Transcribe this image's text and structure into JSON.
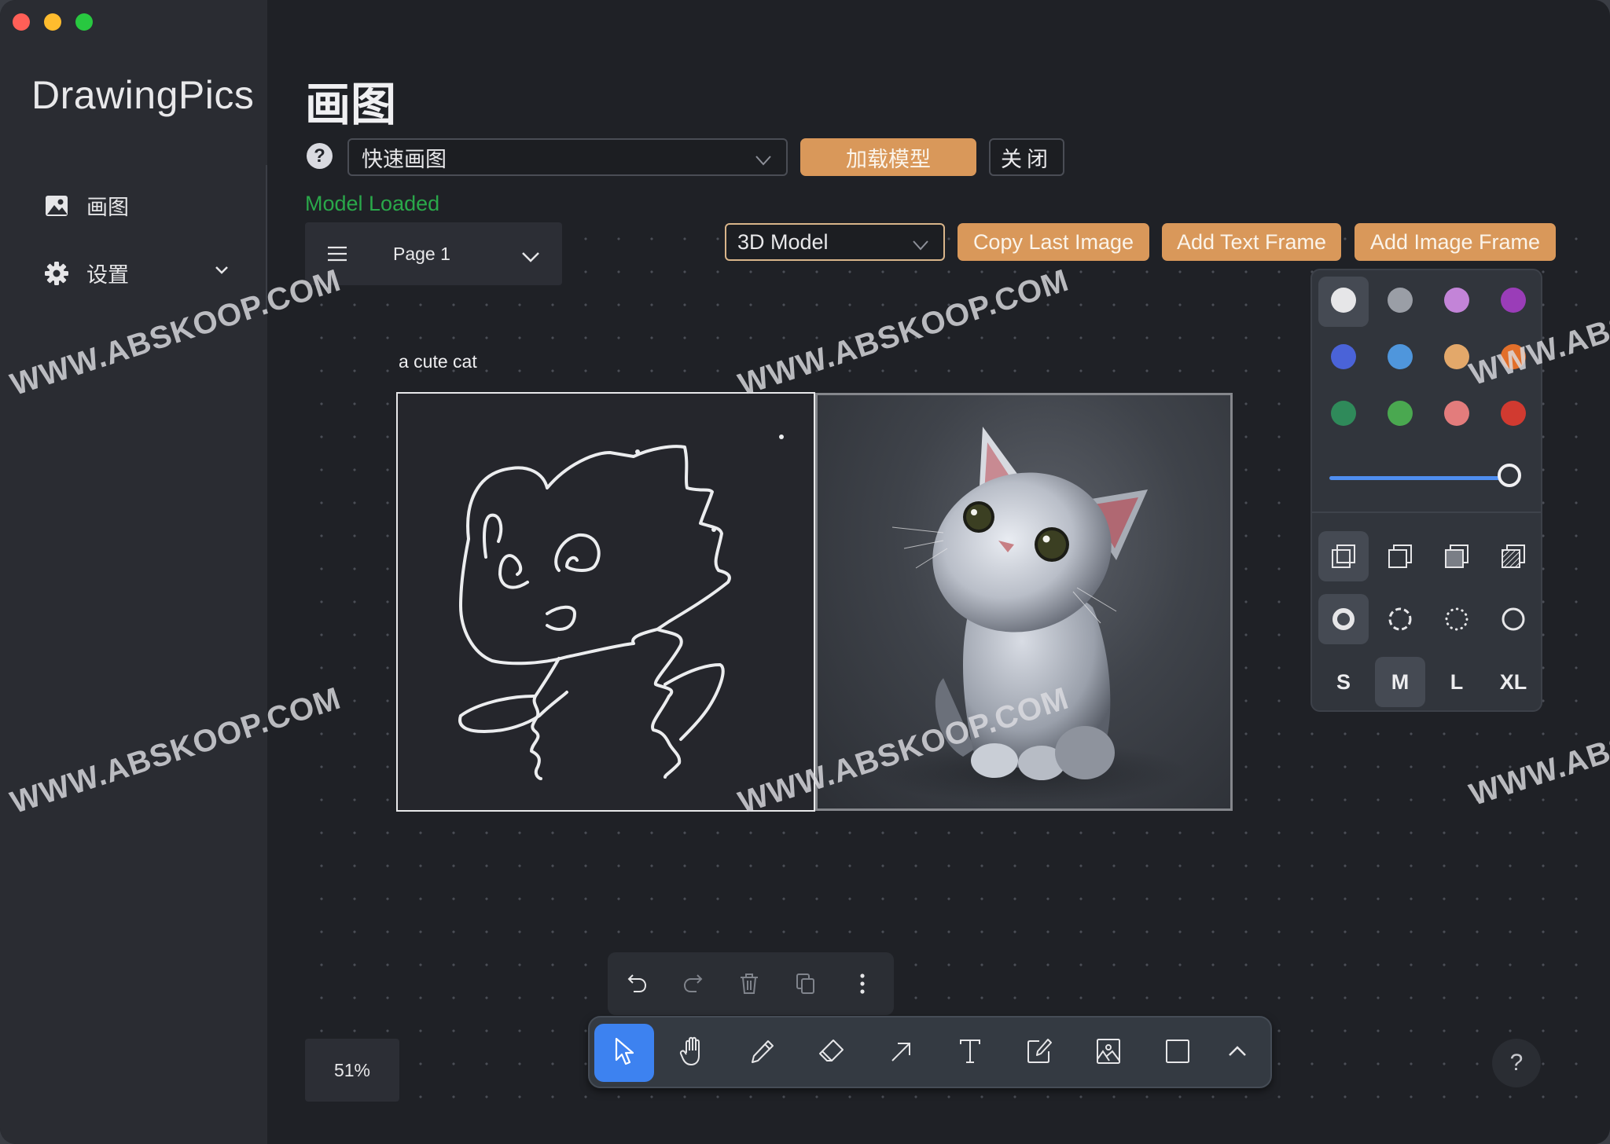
{
  "window": {
    "traffic_lights": [
      {
        "name": "close",
        "color": "#ff5f57"
      },
      {
        "name": "minimize",
        "color": "#febc2e"
      },
      {
        "name": "maximize",
        "color": "#28c840"
      }
    ]
  },
  "sidebar": {
    "app_title": "DrawingPics",
    "items": [
      {
        "label": "画图",
        "icon": "image-icon"
      },
      {
        "label": "设置",
        "icon": "gear-icon",
        "expandable": true
      }
    ]
  },
  "header": {
    "title": "画图",
    "help_label": "?",
    "mode_select": {
      "value": "快速画图"
    },
    "load_model_label": "加载模型",
    "close_label": "关闭",
    "status": "Model Loaded",
    "status_color": "#2aa84a",
    "accent_color": "#d9985a"
  },
  "canvas": {
    "page_selector": {
      "value": "Page 1"
    },
    "model_select": {
      "value": "3D Model"
    },
    "buttons": {
      "copy_last_image": "Copy Last Image",
      "add_text_frame": "Add Text Frame",
      "add_image_frame": "Add Image Frame"
    },
    "frame_label": "a cute cat",
    "zoom": "51%",
    "help_label": "?"
  },
  "style_panel": {
    "colors": [
      {
        "name": "white",
        "hex": "#e6e6e8",
        "selected": true
      },
      {
        "name": "grey",
        "hex": "#9a9ea6"
      },
      {
        "name": "light-violet",
        "hex": "#c384d8"
      },
      {
        "name": "violet",
        "hex": "#9a3db8"
      },
      {
        "name": "blue",
        "hex": "#4a63d8"
      },
      {
        "name": "light-blue",
        "hex": "#4f96dc"
      },
      {
        "name": "yellow",
        "hex": "#e3a86a"
      },
      {
        "name": "orange",
        "hex": "#e26f2a"
      },
      {
        "name": "green",
        "hex": "#2f8a5a"
      },
      {
        "name": "light-green",
        "hex": "#4aa850"
      },
      {
        "name": "light-red",
        "hex": "#e37c7c"
      },
      {
        "name": "red",
        "hex": "#d13a30"
      }
    ],
    "opacity_percent": 100,
    "fill_options": [
      "none",
      "semi",
      "solid",
      "pattern"
    ],
    "fill_selected": "none",
    "dash_options": [
      "draw",
      "dashed",
      "dotted",
      "solid"
    ],
    "dash_selected": "draw",
    "sizes": [
      "S",
      "M",
      "L",
      "XL"
    ],
    "size_selected": "M"
  },
  "actions": [
    "undo",
    "redo",
    "delete",
    "duplicate",
    "more"
  ],
  "toolbar": {
    "tools": [
      "select",
      "hand",
      "draw",
      "eraser",
      "arrow",
      "text",
      "note",
      "asset",
      "rectangle",
      "more"
    ],
    "active": "select"
  },
  "watermark": "WWW.ABSKOOP.COM"
}
